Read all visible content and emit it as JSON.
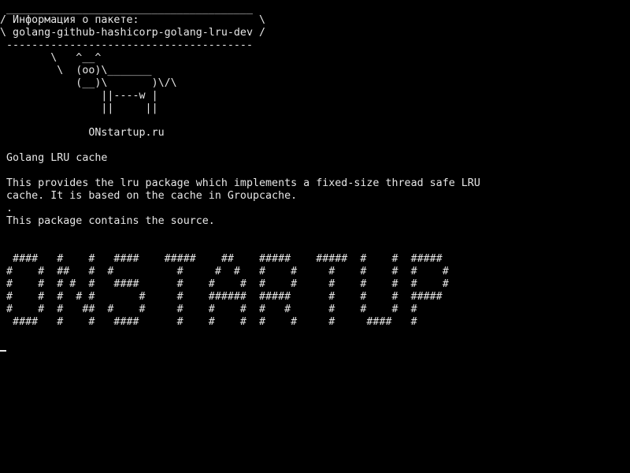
{
  "terminal": {
    "cowsay": {
      "border_top": " _______________________________________",
      "bubble_line_1": "/ Информация о пакете:                   \\",
      "bubble_line_2": "\\ golang-github-hashicorp-golang-lru-dev /",
      "border_bottom": " ---------------------------------------",
      "cow_line_1": "        \\   ^__^",
      "cow_line_2": "         \\  (oo)\\_______",
      "cow_line_3": "            (__)\\       )\\/\\",
      "cow_line_4": "                ||----w |",
      "cow_line_5": "                ||     ||",
      "site": "              ONstartup.ru"
    },
    "package": {
      "summary": " Golang LRU cache",
      "description_line_1": " This provides the lru package which implements a fixed-size thread safe LRU",
      "description_line_2": " cache. It is based on the cache in Groupcache.",
      "description_line_3": " .",
      "description_line_4": " This package contains the source."
    },
    "banner": {
      "line_1": "  ####   #    #   ####    #####    ##    #####    #####  #    #  #####",
      "line_2": " #    #  ##   #  #          #     #  #   #    #     #    #    #  #    #",
      "line_3": " #    #  # #  #   ####      #    #    #  #    #     #    #    #  #    #",
      "line_4": " #    #  #  # #       #     #    ######  #####      #    #    #  #####",
      "line_5": " #    #  #   ##  #    #     #    #    #  #   #      #    #    #  #",
      "line_6": "  ####   #    #   ####      #    #    #  #    #     #     ####   #"
    }
  }
}
